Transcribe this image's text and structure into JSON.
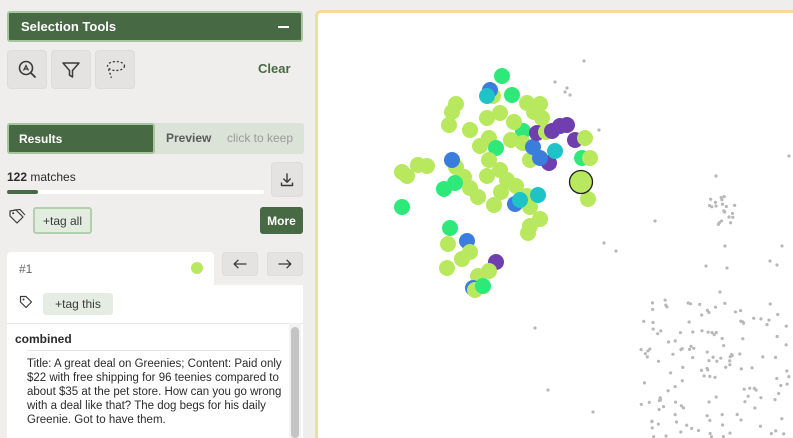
{
  "selection_tools": {
    "title": "Selection Tools",
    "tools": [
      {
        "name": "zoom-select",
        "icon": "magnify-select-icon"
      },
      {
        "name": "filter",
        "icon": "filter-icon"
      },
      {
        "name": "lasso",
        "icon": "lasso-icon"
      }
    ],
    "clear_label": "Clear"
  },
  "tabs": {
    "results_label": "Results",
    "preview_label": "Preview",
    "preview_hint": "click to keep"
  },
  "results": {
    "match_count": "122",
    "match_suffix": "matches",
    "progress_fraction": 0.12,
    "download_icon": "download-icon",
    "tags_icon": "tags-icon",
    "tag_all_label": "+tag all",
    "more_label": "More"
  },
  "current_result": {
    "index_label": "#1",
    "dot_color": "#b7e85d",
    "prev_icon": "arrow-left-icon",
    "next_icon": "arrow-right-icon",
    "tag_icon": "tag-icon",
    "tag_this_label": "+tag this",
    "field_name": "combined",
    "field_text": "Title: A great deal on Greenies; Content: Paid only $22 with free shipping for 96 teenies compared to about $35 at the pet store. How can you go wrong with a deal like that? The dog begs for his daily Greenie. Got to have them."
  },
  "colors": {
    "accent_green": "#476a44",
    "plot_border": "#f3dc9a",
    "cluster_lime": "#b7e85d",
    "cluster_green": "#2ee87a",
    "cluster_blue": "#3b7ddd",
    "cluster_cyan": "#1ec3c8",
    "cluster_purple": "#6f3fb0",
    "background_point": "#b8b8b8"
  }
}
